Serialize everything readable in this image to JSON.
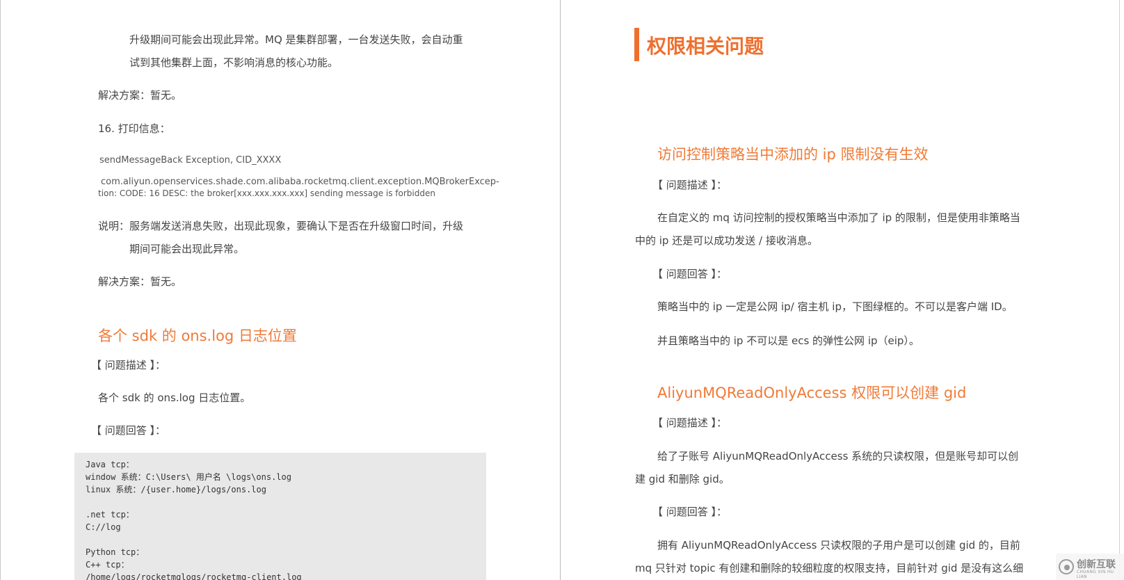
{
  "left": {
    "para1_line1": "升级期间可能会出现此异常。MQ 是集群部署，一台发送失败，会自动重",
    "para1_line2": "试到其他集群上面，不影响消息的核心功能。",
    "solution1": "解决方案：暂无。",
    "item16": "16. 打印信息：",
    "code1": "sendMessageBack Exception, CID_XXXX",
    "code2_line1": "com.aliyun.openservices.shade.com.alibaba.rocketmq.client.exception.MQBrokerExcep-",
    "code2_line2": "tion: CODE: 16  DESC: the broker[xxx.xxx.xxx.xxx] sending message is forbidden",
    "explain_line1": "说明：服务端发送消息失败，出现此现象，要确认下是否在升级窗口时间，升级",
    "explain_line2": "期间可能会出现此异常。",
    "solution2": "解决方案：暂无。",
    "heading": "各个 sdk 的 ons.log 日志位置",
    "q_desc_label": "【 问题描述 】：",
    "q_desc_text": "各个 sdk 的 ons.log 日志位置。",
    "q_answer_label": "【 问题回答 】：",
    "code_block": [
      "Java tcp：",
      "window 系统：C:\\Users\\ 用户名 \\logs\\ons.log",
      "linux 系统：/{user.home}/logs/ons.log",
      "",
      ".net tcp：",
      "C://log",
      "",
      "Python tcp：",
      "C++ tcp：",
      "/home/logs/rocketmqlogs/rocketmq-client.log"
    ]
  },
  "right": {
    "section_title": "权限相关问题",
    "h2_1": "访问控制策略当中添加的 ip 限制没有生效",
    "desc_label_1": "【 问题描述 】：",
    "desc_1_line1": "在自定义的 mq 访问控制的授权策略当中添加了 ip 的限制，但是使用非策略当",
    "desc_1_line2": "中的 ip 还是可以成功发送 / 接收消息。",
    "answer_label_1": "【 问题回答 】：",
    "answer_1a": "策略当中的 ip 一定是公网 ip/ 宿主机 ip，下图绿框的。不可以是客户端 ID。",
    "answer_1b": "并且策略当中的 ip 不可以是 ecs 的弹性公网 ip（eip）。",
    "h2_2": "AliyunMQReadOnlyAccess 权限可以创建 gid",
    "desc_label_2": "【 问题描述 】：",
    "desc_2_line1": "给了子账号 AliyunMQReadOnlyAccess 系统的只读权限，但是账号却可以创",
    "desc_2_line2": "建 gid 和删除 gid。",
    "answer_label_2": "【 问题回答 】：",
    "answer_2_line1": "拥有 AliyunMQReadOnlyAccess 只读权限的子用户是可以创建 gid 的，目前",
    "answer_2_line2": "mq 只针对 topic 有创建和删除的较细粒度的权限支持，目前针对 gid 是没有这么细"
  },
  "watermark": {
    "text": "创新互联",
    "sub": "CHUANG XIN HU LIAN"
  },
  "colors": {
    "accent": "#ef6f2d",
    "code_bg": "#e8e8e8"
  }
}
